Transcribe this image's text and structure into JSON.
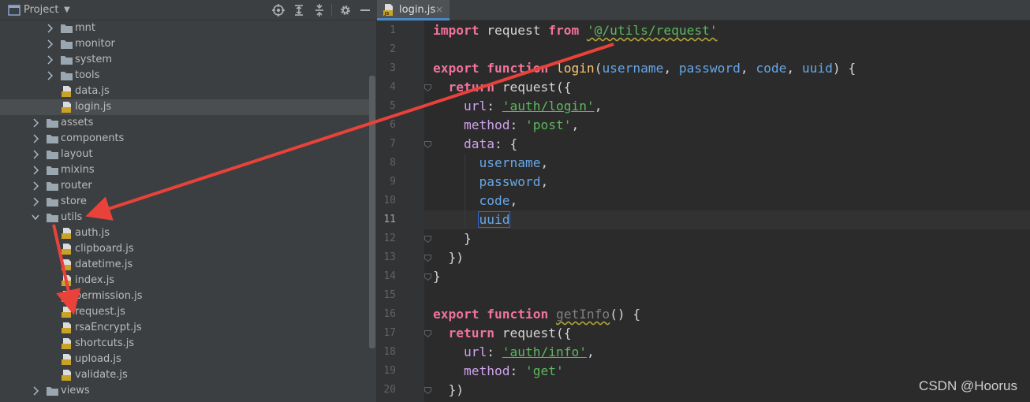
{
  "project": {
    "title": "Project",
    "dropdown_glyph": "▼",
    "toolbar_icons": [
      "target-icon",
      "expand-all-icon",
      "collapse-all-icon",
      "gear-icon",
      "minimize-icon"
    ]
  },
  "tree": {
    "items": [
      {
        "label": "mnt",
        "type": "folder",
        "level": 2,
        "expanded": false
      },
      {
        "label": "monitor",
        "type": "folder",
        "level": 2,
        "expanded": false
      },
      {
        "label": "system",
        "type": "folder",
        "level": 2,
        "expanded": false
      },
      {
        "label": "tools",
        "type": "folder",
        "level": 2,
        "expanded": false
      },
      {
        "label": "data.js",
        "type": "js",
        "level": 2
      },
      {
        "label": "login.js",
        "type": "js",
        "level": 2,
        "selected": true
      },
      {
        "label": "assets",
        "type": "folder",
        "level": 1,
        "expanded": false
      },
      {
        "label": "components",
        "type": "folder",
        "level": 1,
        "expanded": false
      },
      {
        "label": "layout",
        "type": "folder",
        "level": 1,
        "expanded": false
      },
      {
        "label": "mixins",
        "type": "folder",
        "level": 1,
        "expanded": false
      },
      {
        "label": "router",
        "type": "folder",
        "level": 1,
        "expanded": false
      },
      {
        "label": "store",
        "type": "folder",
        "level": 1,
        "expanded": false
      },
      {
        "label": "utils",
        "type": "folder",
        "level": 1,
        "expanded": true
      },
      {
        "label": "auth.js",
        "type": "js",
        "level": 2
      },
      {
        "label": "clipboard.js",
        "type": "js",
        "level": 2
      },
      {
        "label": "datetime.js",
        "type": "js",
        "level": 2
      },
      {
        "label": "index.js",
        "type": "js",
        "level": 2
      },
      {
        "label": "permission.js",
        "type": "js",
        "level": 2
      },
      {
        "label": "request.js",
        "type": "js",
        "level": 2
      },
      {
        "label": "rsaEncrypt.js",
        "type": "js",
        "level": 2
      },
      {
        "label": "shortcuts.js",
        "type": "js",
        "level": 2
      },
      {
        "label": "upload.js",
        "type": "js",
        "level": 2
      },
      {
        "label": "validate.js",
        "type": "js",
        "level": 2
      },
      {
        "label": "views",
        "type": "folder",
        "level": 1,
        "expanded": false
      }
    ]
  },
  "editor": {
    "tab": {
      "label": "login.js",
      "close": "×",
      "icon_text": "JS"
    },
    "current_line": 11,
    "lines": [
      {
        "n": "1",
        "fold": false,
        "tokens": [
          [
            "kw",
            "import"
          ],
          [
            "plain",
            " request "
          ],
          [
            "kw",
            "from"
          ],
          [
            "plain",
            " "
          ],
          [
            "strlink warn",
            "'@/utils/request'"
          ]
        ]
      },
      {
        "n": "2",
        "fold": false,
        "tokens": []
      },
      {
        "n": "3",
        "fold": false,
        "tokens": [
          [
            "kw",
            "export"
          ],
          [
            "plain",
            " "
          ],
          [
            "kw",
            "function"
          ],
          [
            "plain",
            " "
          ],
          [
            "fn",
            "login"
          ],
          [
            "plain",
            "("
          ],
          [
            "param",
            "username"
          ],
          [
            "plain",
            ", "
          ],
          [
            "param",
            "password"
          ],
          [
            "plain",
            ", "
          ],
          [
            "param",
            "code"
          ],
          [
            "plain",
            ", "
          ],
          [
            "param",
            "uuid"
          ],
          [
            "plain",
            ") {"
          ]
        ]
      },
      {
        "n": "4",
        "fold": true,
        "tokens": [
          [
            "plain",
            "  "
          ],
          [
            "kw",
            "return"
          ],
          [
            "plain",
            " request({"
          ]
        ]
      },
      {
        "n": "5",
        "fold": false,
        "tokens": [
          [
            "plain",
            "    "
          ],
          [
            "prop",
            "url"
          ],
          [
            "plain",
            ": "
          ],
          [
            "strlink",
            "'auth/login'"
          ],
          [
            "plain",
            ","
          ]
        ]
      },
      {
        "n": "6",
        "fold": false,
        "tokens": [
          [
            "plain",
            "    "
          ],
          [
            "prop",
            "method"
          ],
          [
            "plain",
            ": "
          ],
          [
            "str",
            "'post'"
          ],
          [
            "plain",
            ","
          ]
        ]
      },
      {
        "n": "7",
        "fold": true,
        "tokens": [
          [
            "plain",
            "    "
          ],
          [
            "prop",
            "data"
          ],
          [
            "plain",
            ": {"
          ]
        ]
      },
      {
        "n": "8",
        "fold": false,
        "tokens": [
          [
            "plain",
            "      "
          ],
          [
            "param",
            "username"
          ],
          [
            "plain",
            ","
          ]
        ]
      },
      {
        "n": "9",
        "fold": false,
        "tokens": [
          [
            "plain",
            "      "
          ],
          [
            "param",
            "password"
          ],
          [
            "plain",
            ","
          ]
        ]
      },
      {
        "n": "10",
        "fold": false,
        "tokens": [
          [
            "plain",
            "      "
          ],
          [
            "param",
            "code"
          ],
          [
            "plain",
            ","
          ]
        ]
      },
      {
        "n": "11",
        "fold": false,
        "tokens": [
          [
            "plain",
            "      "
          ],
          [
            "param caretbox",
            "uuid"
          ]
        ]
      },
      {
        "n": "12",
        "fold": true,
        "tokens": [
          [
            "plain",
            "    }"
          ]
        ]
      },
      {
        "n": "13",
        "fold": true,
        "tokens": [
          [
            "plain",
            "  })"
          ]
        ]
      },
      {
        "n": "14",
        "fold": true,
        "tokens": [
          [
            "plain",
            "}"
          ]
        ]
      },
      {
        "n": "15",
        "fold": false,
        "tokens": []
      },
      {
        "n": "16",
        "fold": false,
        "tokens": [
          [
            "kw",
            "export"
          ],
          [
            "plain",
            " "
          ],
          [
            "kw",
            "function"
          ],
          [
            "plain",
            " "
          ],
          [
            "dim warn",
            "getInfo"
          ],
          [
            "plain",
            "() {"
          ]
        ]
      },
      {
        "n": "17",
        "fold": true,
        "tokens": [
          [
            "plain",
            "  "
          ],
          [
            "kw",
            "return"
          ],
          [
            "plain",
            " request({"
          ]
        ]
      },
      {
        "n": "18",
        "fold": false,
        "tokens": [
          [
            "plain",
            "    "
          ],
          [
            "prop",
            "url"
          ],
          [
            "plain",
            ": "
          ],
          [
            "strlink",
            "'auth/info'"
          ],
          [
            "plain",
            ","
          ]
        ]
      },
      {
        "n": "19",
        "fold": false,
        "tokens": [
          [
            "plain",
            "    "
          ],
          [
            "prop",
            "method"
          ],
          [
            "plain",
            ": "
          ],
          [
            "str",
            "'get'"
          ]
        ]
      },
      {
        "n": "20",
        "fold": true,
        "tokens": [
          [
            "plain",
            "  })"
          ]
        ]
      }
    ]
  },
  "watermark": "CSDN @Hoorus",
  "colors": {
    "annotation_arrow": "#e8423a",
    "folder": "#9aa7b0",
    "js_icon": "#c9a228"
  }
}
